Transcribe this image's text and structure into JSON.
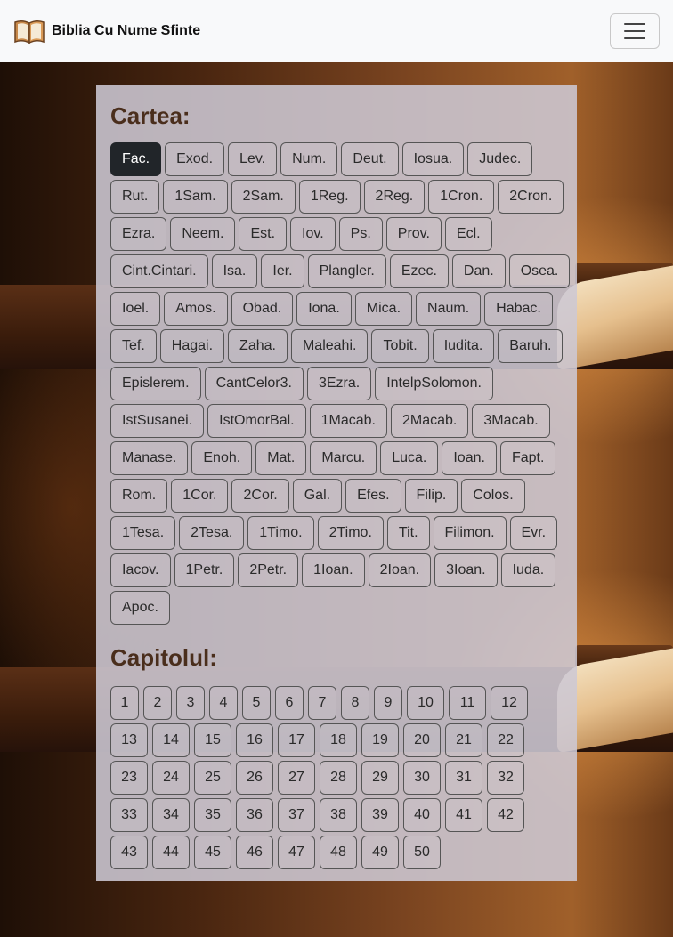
{
  "navbar": {
    "brand_icon": "open-book-icon",
    "brand_text": "Biblia Cu Nume Sfinte",
    "toggler_icon": "hamburger-menu-icon"
  },
  "books_section": {
    "title": "Cartea:",
    "active": "Fac.",
    "items": [
      "Fac.",
      "Exod.",
      "Lev.",
      "Num.",
      "Deut.",
      "Iosua.",
      "Judec.",
      "Rut.",
      "1Sam.",
      "2Sam.",
      "1Reg.",
      "2Reg.",
      "1Cron.",
      "2Cron.",
      "Ezra.",
      "Neem.",
      "Est.",
      "Iov.",
      "Ps.",
      "Prov.",
      "Ecl.",
      "Cint.Cintari.",
      "Isa.",
      "Ier.",
      "Plangler.",
      "Ezec.",
      "Dan.",
      "Osea.",
      "Ioel.",
      "Amos.",
      "Obad.",
      "Iona.",
      "Mica.",
      "Naum.",
      "Habac.",
      "Tef.",
      "Hagai.",
      "Zaha.",
      "Maleahi.",
      "Tobit.",
      "Iudita.",
      "Baruh.",
      "Epislerem.",
      "CantCelor3.",
      "3Ezra.",
      "IntelpSolomon.",
      "IstSusanei.",
      "IstOmorBal.",
      "1Macab.",
      "2Macab.",
      "3Macab.",
      "Manase.",
      "Enoh.",
      "Mat.",
      "Marcu.",
      "Luca.",
      "Ioan.",
      "Fapt.",
      "Rom.",
      "1Cor.",
      "2Cor.",
      "Gal.",
      "Efes.",
      "Filip.",
      "Colos.",
      "1Tesa.",
      "2Tesa.",
      "1Timo.",
      "2Timo.",
      "Tit.",
      "Filimon.",
      "Evr.",
      "Iacov.",
      "1Petr.",
      "2Petr.",
      "1Ioan.",
      "2Ioan.",
      "3Ioan.",
      "Iuda.",
      "Apoc."
    ]
  },
  "chapters_section": {
    "title": "Capitolul:",
    "items": [
      "1",
      "2",
      "3",
      "4",
      "5",
      "6",
      "7",
      "8",
      "9",
      "10",
      "11",
      "12",
      "13",
      "14",
      "15",
      "16",
      "17",
      "18",
      "19",
      "20",
      "21",
      "22",
      "23",
      "24",
      "25",
      "26",
      "27",
      "28",
      "29",
      "30",
      "31",
      "32",
      "33",
      "34",
      "35",
      "36",
      "37",
      "38",
      "39",
      "40",
      "41",
      "42",
      "43",
      "44",
      "45",
      "46",
      "47",
      "48",
      "49",
      "50"
    ]
  },
  "colors": {
    "navbar_bg": "#f8f9fa",
    "heading": "#4a2e1c",
    "active_button": "#212529"
  }
}
